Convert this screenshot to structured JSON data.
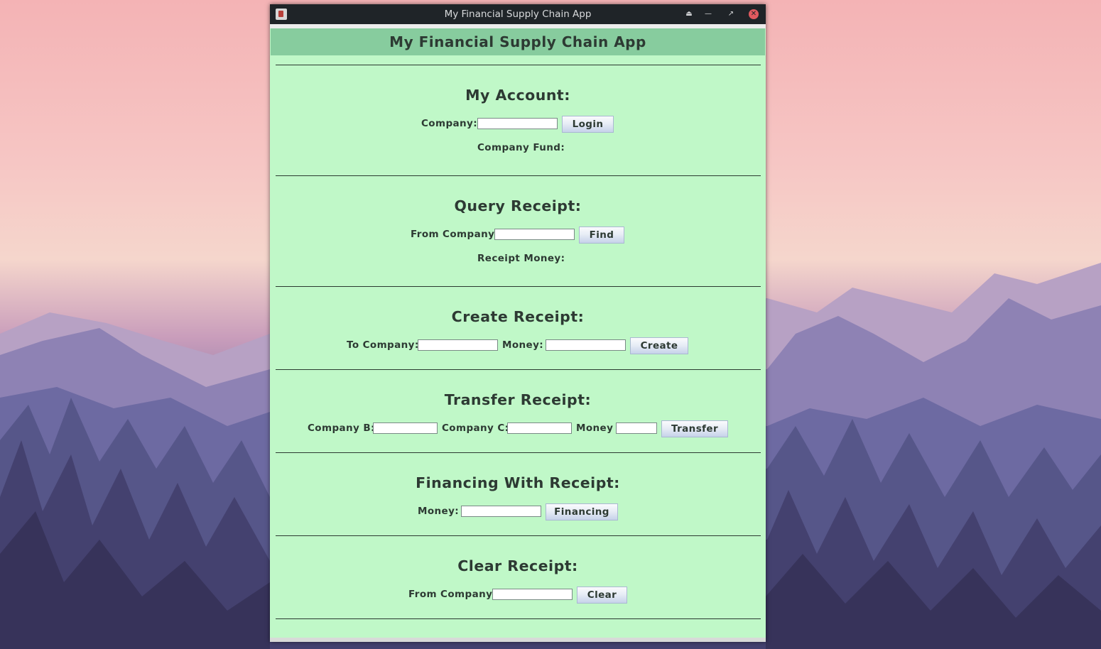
{
  "window": {
    "title": "My Financial Supply Chain App",
    "controls": [
      "keep-above",
      "minimize",
      "maximize",
      "close"
    ]
  },
  "header": {
    "title": "My Financial Supply Chain App"
  },
  "divider_text": "",
  "account": {
    "title": "My Account:",
    "company_label": "Company:",
    "company_value": "",
    "login_label": "Login",
    "fund_label": "Company Fund:"
  },
  "query": {
    "title": "Query Receipt:",
    "from_label": "From Company:",
    "from_value": "",
    "find_label": "Find",
    "money_label": "Receipt Money:"
  },
  "create": {
    "title": "Create Receipt:",
    "to_label": "To Company:",
    "to_value": "",
    "money_label": "Money:",
    "money_value": "",
    "create_label": "Create"
  },
  "transfer": {
    "title": "Transfer Receipt:",
    "b_label": "Company B:",
    "b_value": "",
    "c_label": "Company C:",
    "c_value": "",
    "money_label": "Money",
    "money_value": "",
    "transfer_label": "Transfer"
  },
  "financing": {
    "title": "Financing With Receipt:",
    "money_label": "Money:",
    "money_value": "",
    "financing_label": "Financing"
  },
  "clear": {
    "title": "Clear Receipt:",
    "from_label": "From Company:",
    "from_value": "",
    "clear_label": "Clear"
  },
  "colors": {
    "panel_bg": "#c0f8c8",
    "header_bg": "#87cc9e",
    "titlebar_bg": "#1f2428",
    "close_button": "#e05a5f"
  }
}
